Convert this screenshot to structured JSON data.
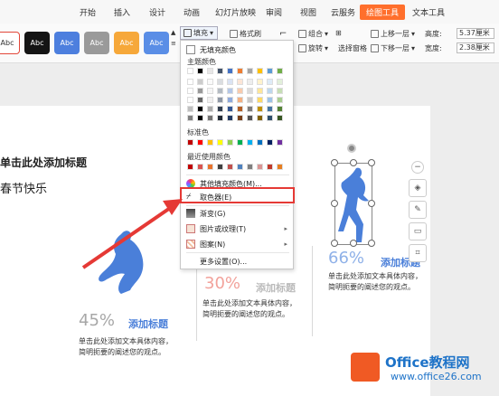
{
  "ribbon": {
    "tabs": [
      "开始",
      "插入",
      "设计",
      "动画",
      "幻灯片放映",
      "审阅",
      "视图",
      "云服务",
      "绘图工具",
      "文本工具"
    ],
    "active_tab": "绘图工具",
    "style_swatches": [
      "Abc",
      "Abc",
      "Abc",
      "Abc",
      "Abc",
      "Abc"
    ],
    "fill_button": "填充",
    "format_painter": "格式刷",
    "group": "组合",
    "rotate": "旋转",
    "selection_pane": "选择窗格",
    "bring_forward": "上移一层",
    "send_backward": "下移一层",
    "height_label": "高度:",
    "height_value": "5.37厘米",
    "width_label": "宽度:",
    "width_value": "2.38厘米"
  },
  "menu": {
    "no_fill": "无填充颜色",
    "theme_colors": "主题颜色",
    "standard_colors": "标准色",
    "recent_colors": "最近使用颜色",
    "more_colors": "其他填充颜色(M)...",
    "eyedropper": "取色器(E)",
    "gradient": "渐变(G)",
    "picture_texture": "图片或纹理(T)",
    "pattern": "图案(N)",
    "more_settings": "更多设置(O)...",
    "theme_row1": [
      "#ffffff",
      "#000000",
      "#e7e6e6",
      "#44546a",
      "#4472c4",
      "#ed7d31",
      "#a5a5a5",
      "#ffc000",
      "#5b9bd5",
      "#70ad47"
    ],
    "standard_row": [
      "#c00000",
      "#ff0000",
      "#ffc000",
      "#ffff00",
      "#92d050",
      "#00b050",
      "#00b0f0",
      "#0070c0",
      "#002060",
      "#7030a0"
    ],
    "recent_row": [
      "#c00000",
      "#d9534f",
      "#e8732c",
      "#404040",
      "#c0504d",
      "#4f81bd",
      "#7f7f7f",
      "#d99594",
      "#c0392b",
      "#e67e22"
    ]
  },
  "slide": {
    "title": "单击此处添加标题",
    "subtitle": "春节快乐",
    "col1": {
      "pct": "45%",
      "title": "添加标题",
      "line1": "单击此处添加文本具体内容，",
      "line2": "简明扼要的阐述您的观点。"
    },
    "col2": {
      "pct": "30%",
      "title": "添加标题",
      "line1": "单击此处添加文本具体内容，",
      "line2": "简明扼要的阐述您的观点。"
    },
    "col3": {
      "pct": "66%",
      "title": "添加标题",
      "line1": "单击此处添加文本具体内容，",
      "line2": "简明扼要的阐述您的观点。"
    }
  },
  "watermark": {
    "brand": "Office教程网",
    "url": "www.office26.com"
  },
  "colors": {
    "accent": "#ff6f2c",
    "highlight": "#e53935",
    "runner_blue": "#4a7fd9"
  }
}
